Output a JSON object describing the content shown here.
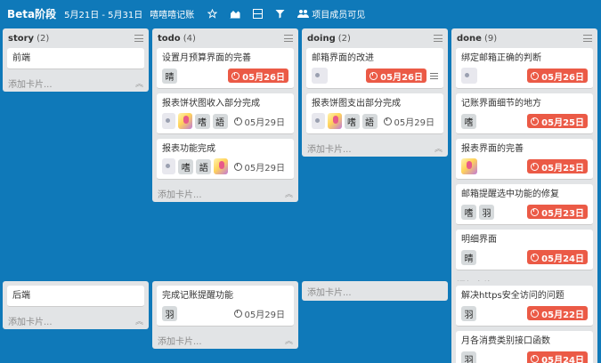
{
  "board": {
    "title": "Beta阶段",
    "dates": "5月21日 - 5月31日",
    "team": "嘻嘻嘻记账",
    "visibility": "项目成员可见",
    "bg_color": "#0f79b9"
  },
  "add_card_label": "添加卡片...",
  "lists": {
    "story": {
      "name": "story",
      "count": "(2)",
      "cards": [
        {
          "title": "前端"
        }
      ]
    },
    "todo": {
      "name": "todo",
      "count": "(4)",
      "cards": [
        {
          "title": "设置月预算界面的完善",
          "members": [
            "晴"
          ],
          "due": "05月26日"
        },
        {
          "title": "报表饼状图收入部分完成",
          "members": [
            "嗜",
            "語"
          ],
          "due": "05月29日"
        },
        {
          "title": "报表功能完成",
          "members": [
            "嗜",
            "語"
          ],
          "due": "05月29日"
        }
      ]
    },
    "doing": {
      "name": "doing",
      "count": "(2)",
      "cards": [
        {
          "title": "邮箱界面的改进",
          "due": "05月26日"
        },
        {
          "title": "报表饼图支出部分完成",
          "members": [
            "嗜",
            "語"
          ],
          "due": "05月29日"
        }
      ]
    },
    "done": {
      "name": "done",
      "count": "(9)",
      "cards": [
        {
          "title": "绑定邮箱正确的判断",
          "due": "05月26日"
        },
        {
          "title": "记账界面细节的地方",
          "members": [
            "嗜"
          ],
          "due": "05月25日"
        },
        {
          "title": "报表界面的完善",
          "due": "05月25日"
        },
        {
          "title": "邮箱提醒选中功能的修复",
          "members": [
            "嗜",
            "羽"
          ],
          "due": "05月23日"
        },
        {
          "title": "明细界面",
          "members": [
            "晴"
          ],
          "due": "05月24日"
        }
      ]
    },
    "story_b": {
      "cards": [
        {
          "title": "后端"
        }
      ]
    },
    "todo_b": {
      "cards": [
        {
          "title": "完成记账提醒功能",
          "members": [
            "羽"
          ],
          "due": "05月29日"
        }
      ]
    },
    "done_b": {
      "cards": [
        {
          "title": "解决https安全访问的问题",
          "members": [
            "羽"
          ],
          "due": "05月22日"
        },
        {
          "title": "月各消费类别接口函数",
          "members": [
            "羽"
          ],
          "due": "05月24日"
        }
      ]
    }
  },
  "colors": {
    "overdue": "#eb5a46",
    "list_bg": "#e2e4e6"
  },
  "icons": {
    "star": "star-icon",
    "chart": "chart-icon",
    "grid": "grid-icon",
    "filter": "filter-icon",
    "members": "members-icon"
  }
}
